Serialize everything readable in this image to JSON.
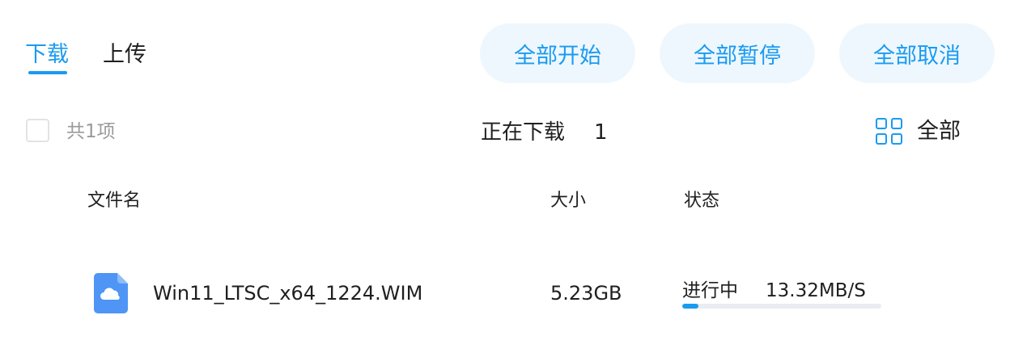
{
  "tabs": {
    "download": "下载",
    "upload": "上传"
  },
  "actions": {
    "start_all": "全部开始",
    "pause_all": "全部暂停",
    "cancel_all": "全部取消"
  },
  "summary": {
    "count_text": "共1项",
    "downloading_label": "正在下载",
    "downloading_count": "1",
    "filter_label": "全部",
    "filter_icon": "grid-icon"
  },
  "table": {
    "headers": {
      "name": "文件名",
      "size": "大小",
      "status": "状态"
    },
    "rows": [
      {
        "icon": "cloud-file-icon",
        "name": "Win11_LTSC_x64_1224.WIM",
        "size": "5.23GB",
        "status": "进行中",
        "speed": "13.32MB/S",
        "progress": 0.08
      }
    ]
  },
  "colors": {
    "accent": "#1a9bf0",
    "pill_bg": "#eef7fe",
    "muted_text": "#9a9a9a",
    "file_icon": "#4e95f5"
  }
}
